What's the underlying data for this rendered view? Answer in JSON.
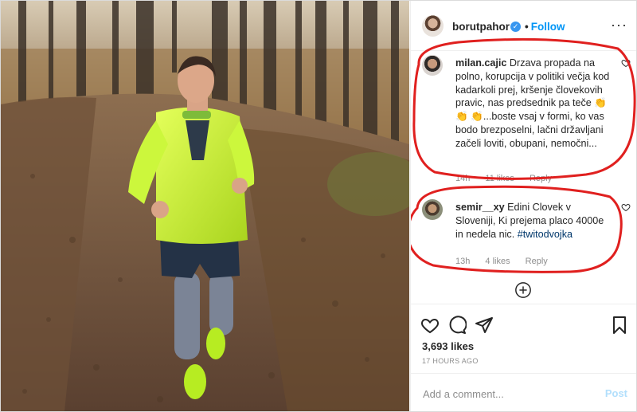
{
  "post": {
    "author": "borutpahor",
    "follow_label": "Follow",
    "dot": "•",
    "more_icon": "more-options-icon",
    "likes": "3,693 likes",
    "time": "17 HOURS AGO",
    "add_comment_placeholder": "Add a comment...",
    "post_label": "Post"
  },
  "comments": [
    {
      "user": "milan.cajic",
      "text": "Drzava propada na polno, korupcija v politiki večja kod kadarkoli prej, kršenje človekovih pravic, nas predsednik pa teče 👏👏 👏...boste vsaj v formi, ko vas bodo brezposelni, lačni državljani začeli loviti, obupani, nemočni...",
      "age": "14h",
      "likes": "11 likes",
      "reply": "Reply"
    },
    {
      "user": "semir__xy",
      "text": "Edini Clovek v Sloveniji, Ki prejema placo 4000e in nedela nic.",
      "hashtag": "#twitodvojka",
      "age": "13h",
      "likes": "4 likes",
      "reply": "Reply"
    }
  ],
  "colors": {
    "accent": "#0095f6",
    "annotation": "#e0201f",
    "jacket": "#c8f135"
  }
}
